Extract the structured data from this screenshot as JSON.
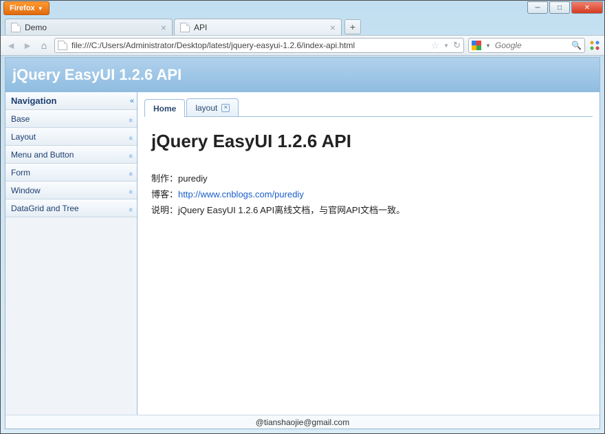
{
  "chrome": {
    "firefox_label": "Firefox",
    "tabs": [
      {
        "title": "Demo"
      },
      {
        "title": "API"
      }
    ],
    "url": "file:///C:/Users/Administrator/Desktop/latest/jquery-easyui-1.2.6/index-api.html",
    "search_placeholder": "Google"
  },
  "header_title": "jQuery EasyUI 1.2.6 API",
  "sidebar": {
    "title": "Navigation",
    "items": [
      {
        "label": "Base"
      },
      {
        "label": "Layout"
      },
      {
        "label": "Menu and Button"
      },
      {
        "label": "Form"
      },
      {
        "label": "Window"
      },
      {
        "label": "DataGrid and Tree"
      }
    ]
  },
  "content_tabs": [
    {
      "label": "Home",
      "closable": false,
      "active": true
    },
    {
      "label": "layout",
      "closable": true,
      "active": false
    }
  ],
  "article": {
    "heading": "jQuery EasyUI 1.2.6 API",
    "line1_label": "制作：",
    "line1_value": "purediy",
    "line2_label": "博客：",
    "line2_link": "http://www.cnblogs.com/purediy",
    "line3_label": "说明：",
    "line3_value": "jQuery EasyUI 1.2.6 API离线文档，与官网API文档一致。"
  },
  "footer_email": "@tianshaojie@gmail.com"
}
